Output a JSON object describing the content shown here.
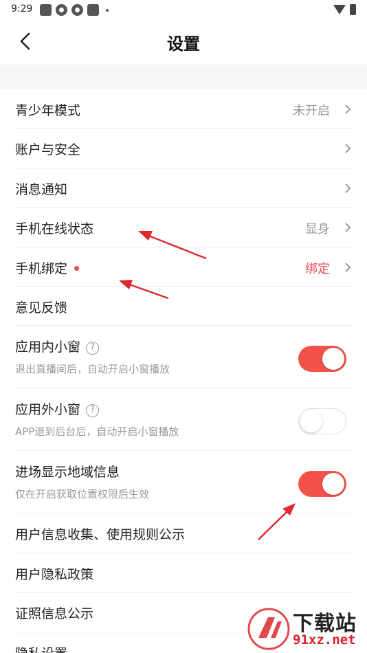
{
  "status_bar": {
    "time": "9:29"
  },
  "header": {
    "title": "设置",
    "back_icon": "chevron-left-icon"
  },
  "settings": {
    "teen_mode": {
      "label": "青少年模式",
      "value": "未开启"
    },
    "account_security": {
      "label": "账户与安全"
    },
    "notifications": {
      "label": "消息通知"
    },
    "online_status": {
      "label": "手机在线状态",
      "value": "显身"
    },
    "phone_binding": {
      "label": "手机绑定",
      "value": "绑定"
    },
    "feedback": {
      "label": "意见反馈"
    },
    "in_app_window": {
      "label": "应用内小窗",
      "subtitle": "退出直播间后，自动开启小窗播放",
      "enabled": true
    },
    "out_app_window": {
      "label": "应用外小窗",
      "subtitle": "APP退到后台后，自动开启小窗播放",
      "enabled": false
    },
    "show_region": {
      "label": "进场显示地域信息",
      "subtitle": "仅在开启获取位置权限后生效",
      "enabled": true
    },
    "info_collection": {
      "label": "用户信息收集、使用规则公示"
    },
    "privacy_policy": {
      "label": "用户隐私政策"
    },
    "license_info": {
      "label": "证照信息公示"
    },
    "privacy_settings": {
      "label": "隐私设置"
    }
  },
  "colors": {
    "accent": "#f2524a",
    "value_red": "#f04a52",
    "muted": "#999999"
  },
  "watermark": {
    "text": "下载站",
    "url": "91xz.net"
  }
}
